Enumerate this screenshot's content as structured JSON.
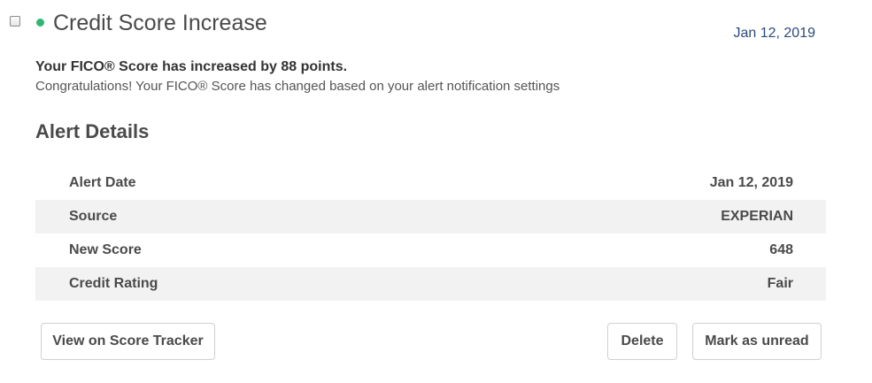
{
  "alert": {
    "title": "Credit Score Increase",
    "date": "Jan 12, 2019",
    "headline": "Your FICO® Score has increased by 88 points.",
    "message": "Congratulations! Your FICO® Score has changed based on your alert notification settings",
    "status_color": "#2eb872"
  },
  "details": {
    "title": "Alert Details",
    "rows": [
      {
        "label": "Alert Date",
        "value": "Jan 12, 2019"
      },
      {
        "label": "Source",
        "value": "EXPERIAN"
      },
      {
        "label": "New Score",
        "value": "648"
      },
      {
        "label": "Credit Rating",
        "value": "Fair"
      }
    ]
  },
  "actions": {
    "tracker_label": "View on Score Tracker",
    "delete_label": "Delete",
    "unread_label": "Mark as unread"
  }
}
